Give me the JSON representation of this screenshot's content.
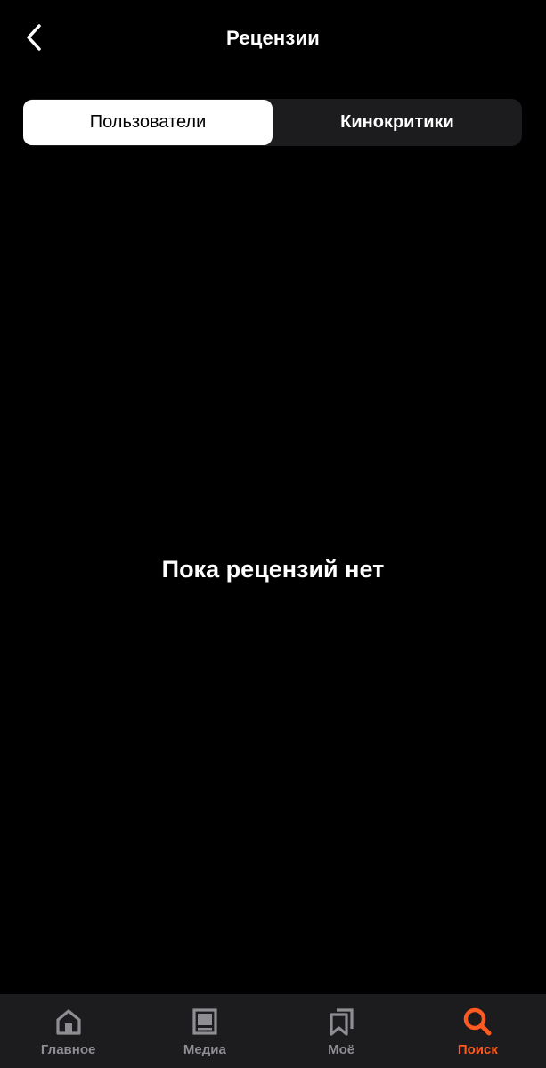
{
  "header": {
    "title": "Рецензии",
    "back_icon": "chevron-left-icon"
  },
  "segments": [
    {
      "label": "Пользователи",
      "selected": true
    },
    {
      "label": "Кинокритики",
      "selected": false
    }
  ],
  "empty_state": {
    "message": "Пока рецензий нет"
  },
  "tabbar": {
    "items": [
      {
        "label": "Главное",
        "icon": "home-icon",
        "active": false
      },
      {
        "label": "Медиа",
        "icon": "media-icon",
        "active": false
      },
      {
        "label": "Моё",
        "icon": "bookmarks-icon",
        "active": false
      },
      {
        "label": "Поиск",
        "icon": "search-icon",
        "active": true
      }
    ]
  },
  "colors": {
    "background": "#000000",
    "surface": "#1c1c1e",
    "accent": "#ff5a1f",
    "inactive": "#8e8e93"
  }
}
